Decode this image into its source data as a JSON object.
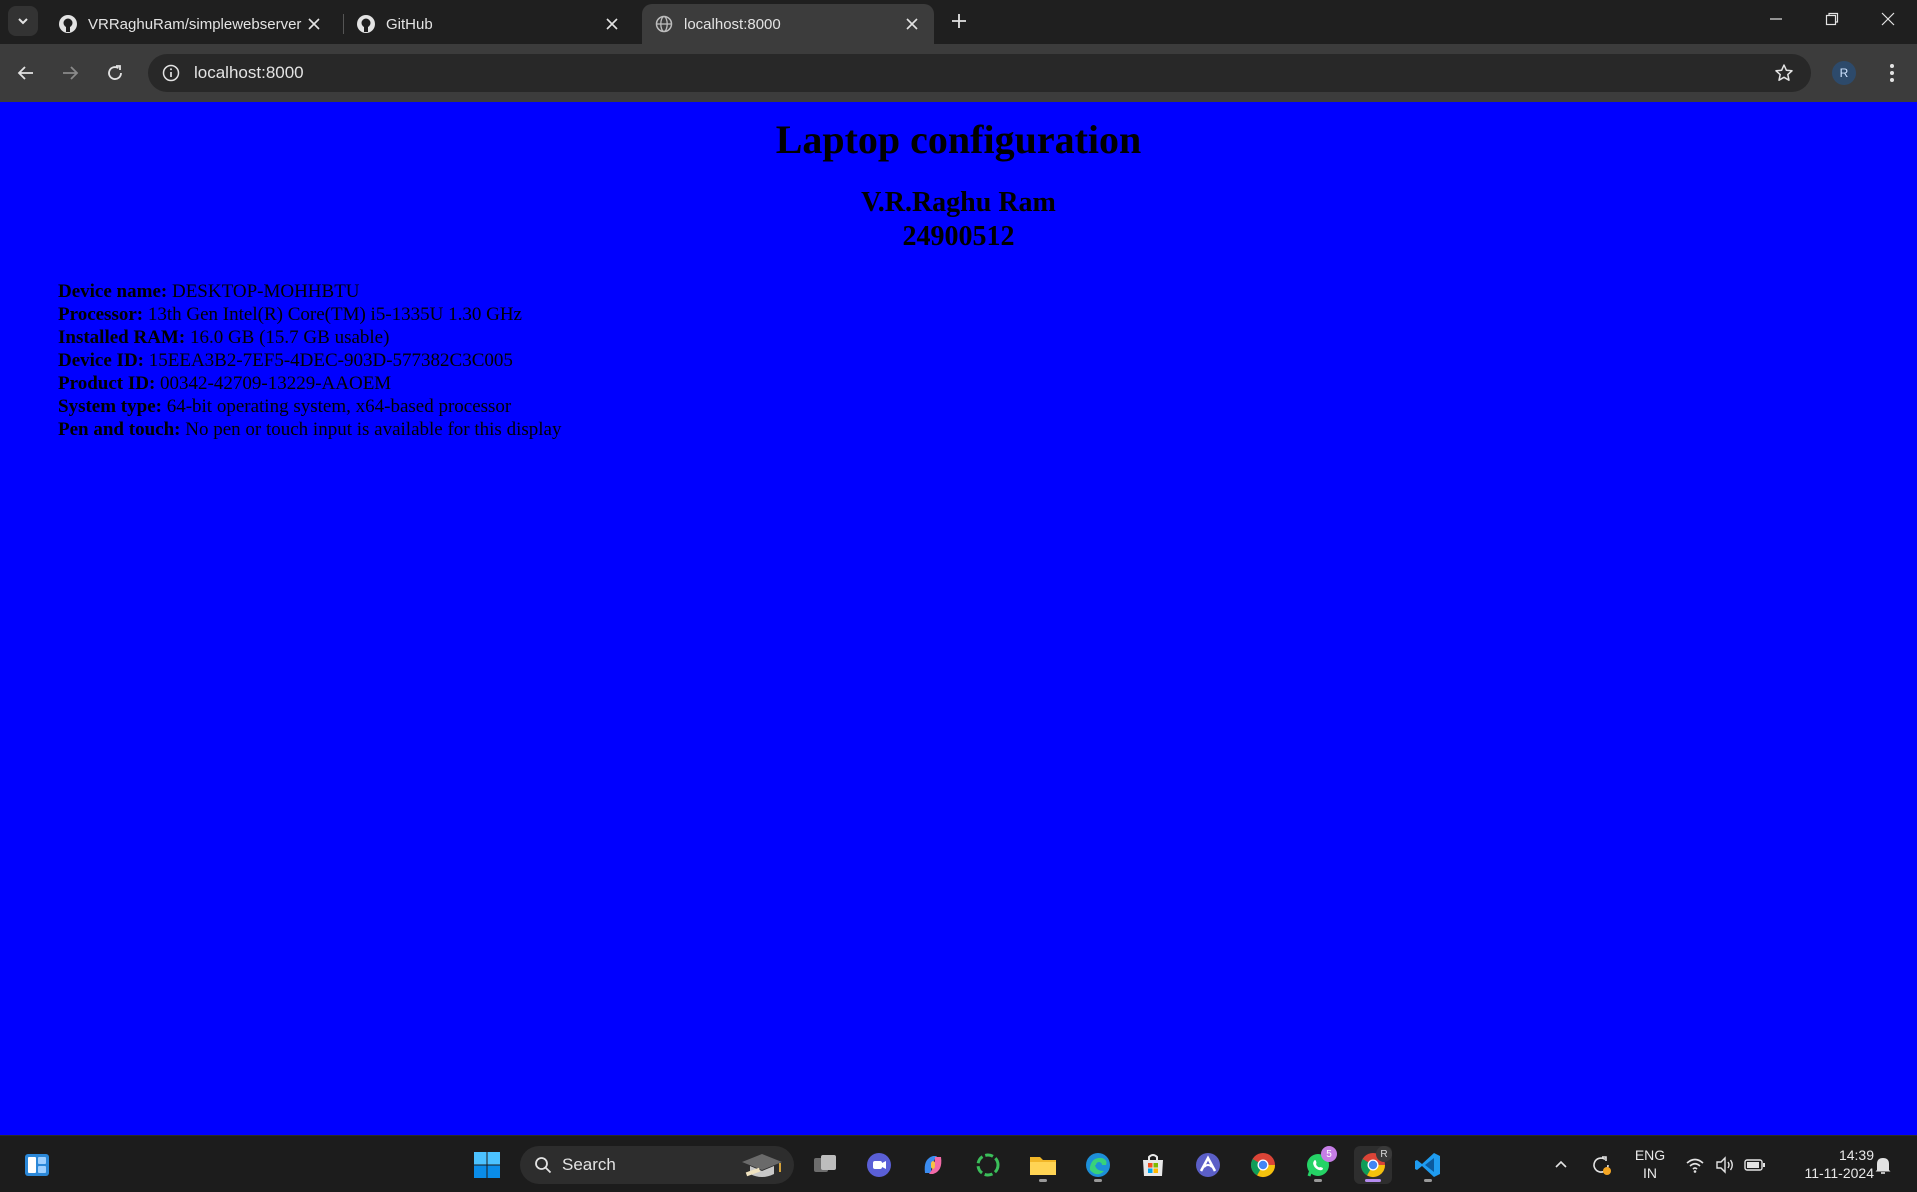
{
  "browser": {
    "tabs": [
      {
        "title": "VRRaghuRam/simplewebserver",
        "icon": "github-icon",
        "active": false
      },
      {
        "title": "GitHub",
        "icon": "github-icon",
        "active": false
      },
      {
        "title": "localhost:8000",
        "icon": "globe-icon",
        "active": true
      }
    ],
    "address": "localhost:8000",
    "profile_initial": "R"
  },
  "page": {
    "title": "Laptop configuration",
    "author_name": "V.R.Raghu Ram",
    "author_id": "24900512",
    "specs": [
      {
        "label": "Device name:",
        "value": "DESKTOP-MOHHBTU"
      },
      {
        "label": "Processor:",
        "value": "13th Gen Intel(R) Core(TM) i5-1335U 1.30 GHz"
      },
      {
        "label": "Installed RAM:",
        "value": "16.0 GB (15.7 GB usable)"
      },
      {
        "label": "Device ID:",
        "value": "15EEA3B2-7EF5-4DEC-903D-577382C3C005"
      },
      {
        "label": "Product ID:",
        "value": "00342-42709-13229-AAOEM"
      },
      {
        "label": "System type:",
        "value": "64-bit operating system, x64-based processor"
      },
      {
        "label": "Pen and touch:",
        "value": "No pen or touch input is available for this display"
      }
    ],
    "background_color": "#0000ff"
  },
  "taskbar": {
    "search_placeholder": "Search",
    "whatsapp_badge": "5",
    "chrome_profile_badge": "R",
    "language_line1": "ENG",
    "language_line2": "IN",
    "time": "14:39",
    "date": "11-11-2024"
  }
}
